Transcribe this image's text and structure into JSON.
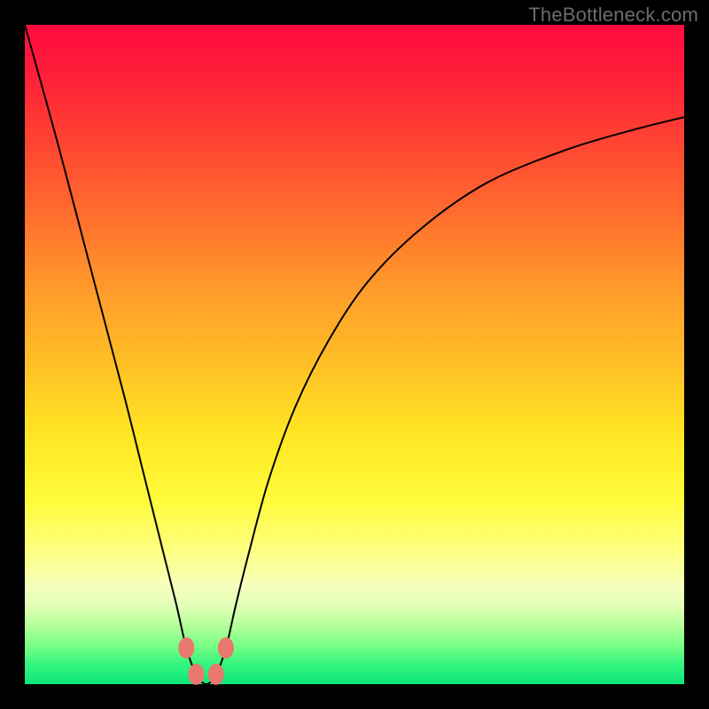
{
  "watermark": "TheBottleneck.com",
  "colors": {
    "page_bg": "#000000",
    "curve": "#000000",
    "markers": "#e9786f",
    "gradient_top": "#ff0b3f",
    "gradient_bottom": "#0de57a"
  },
  "chart_data": {
    "type": "line",
    "title": "",
    "xlabel": "",
    "ylabel": "",
    "xlim": [
      0,
      1
    ],
    "ylim": [
      0,
      1
    ],
    "note": "Axes are not labeled; values are fractional positions in the plot area. Y=1 at top (red), Y=0 at bottom (green). Curve is a V-shaped dip to ~0 near x≈0.28 then rises asymptotically.",
    "series": [
      {
        "name": "curve",
        "x": [
          0.0,
          0.05,
          0.1,
          0.15,
          0.18,
          0.21,
          0.23,
          0.245,
          0.26,
          0.275,
          0.29,
          0.305,
          0.32,
          0.34,
          0.37,
          0.41,
          0.46,
          0.52,
          0.6,
          0.7,
          0.82,
          0.92,
          1.0
        ],
        "y": [
          1.0,
          0.82,
          0.63,
          0.44,
          0.32,
          0.2,
          0.12,
          0.055,
          0.015,
          0.0,
          0.015,
          0.055,
          0.12,
          0.2,
          0.31,
          0.42,
          0.52,
          0.61,
          0.69,
          0.76,
          0.81,
          0.84,
          0.86
        ]
      }
    ],
    "markers": [
      {
        "x": 0.245,
        "y": 0.055
      },
      {
        "x": 0.305,
        "y": 0.055
      },
      {
        "x": 0.26,
        "y": 0.015
      },
      {
        "x": 0.29,
        "y": 0.015
      }
    ]
  }
}
